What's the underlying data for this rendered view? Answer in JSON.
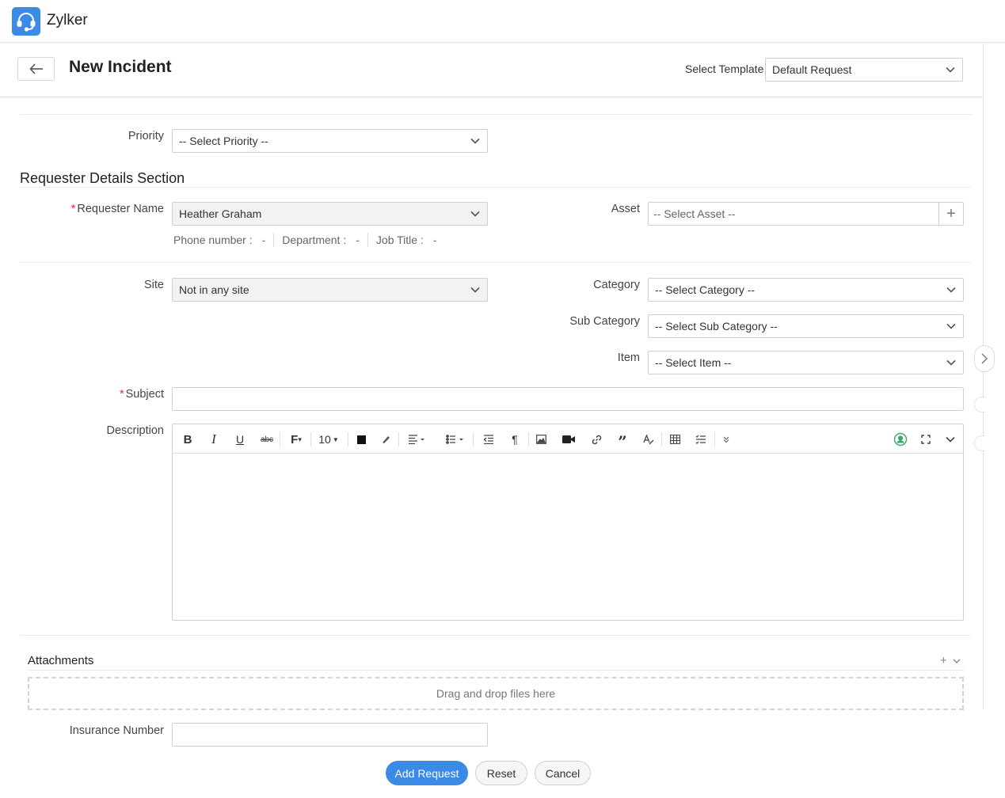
{
  "app": {
    "name": "Zylker",
    "logo_icon": "headset-icon",
    "accent_color": "#3b8be6"
  },
  "header": {
    "title": "New Incident",
    "template_label": "Select Template",
    "template_value": "Default Request"
  },
  "form": {
    "priority": {
      "label": "Priority",
      "value": "-- Select Priority --"
    },
    "requester_section_title": "Requester Details Section",
    "requester": {
      "required_mark": "*",
      "label": "Requester Name",
      "value": "Heather Graham",
      "phone_label": "Phone number :",
      "phone_value": "-",
      "department_label": "Department :",
      "department_value": "-",
      "jobtitle_label": "Job Title :",
      "jobtitle_value": "-"
    },
    "asset": {
      "label": "Asset",
      "placeholder": "-- Select Asset --",
      "add_symbol": "+"
    },
    "site": {
      "label": "Site",
      "value": "Not in any site"
    },
    "category": {
      "label": "Category",
      "value": "-- Select Category --"
    },
    "sub_category": {
      "label": "Sub Category",
      "value": "-- Select Sub Category --"
    },
    "item": {
      "label": "Item",
      "value": "-- Select Item --"
    },
    "subject": {
      "required_mark": "*",
      "label": "Subject",
      "value": ""
    },
    "description": {
      "label": "Description",
      "font_size": "10"
    },
    "attachments": {
      "title": "Attachments",
      "dropzone_text": "Drag and drop files here",
      "add_symbol": "+"
    },
    "insurance": {
      "label": "Insurance Number",
      "value": ""
    }
  },
  "actions": {
    "add": "Add Request",
    "reset": "Reset",
    "cancel": "Cancel"
  },
  "required_color": "#e0312f"
}
